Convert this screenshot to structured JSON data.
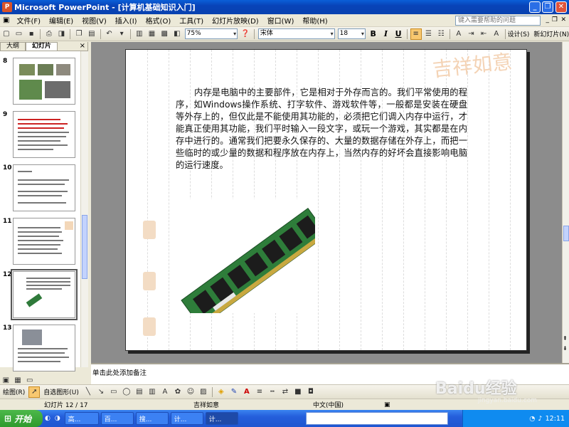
{
  "window": {
    "app_icon": "P",
    "title": "Microsoft PowerPoint - [计算机基础知识入门]",
    "minimize": "_",
    "restore": "❐",
    "close": "✕"
  },
  "menu": {
    "items": [
      "文件(F)",
      "编辑(E)",
      "视图(V)",
      "插入(I)",
      "格式(O)",
      "工具(T)",
      "幻灯片放映(D)",
      "窗口(W)",
      "帮助(H)"
    ],
    "help_placeholder": "键入需要帮助的问题",
    "doc_min": "_",
    "doc_restore": "❐",
    "doc_close": "✕"
  },
  "toolbar": {
    "zoom": "75%",
    "font": "宋体",
    "size": "18",
    "bold": "B",
    "italic": "I",
    "underline": "U",
    "design_label": "设计(S)",
    "new_slide_label": "新幻灯片(N)"
  },
  "pane_tabs": {
    "outline": "大纲",
    "slides": "幻灯片",
    "close": "×"
  },
  "thumbnails": [
    {
      "num": "8"
    },
    {
      "num": "9"
    },
    {
      "num": "10"
    },
    {
      "num": "11"
    },
    {
      "num": "12"
    },
    {
      "num": "13"
    }
  ],
  "slide": {
    "text": "内存是电脑中的主要部件，它是相对于外存而言的。我们平常使用的程序，如Windows操作系统、打字软件、游戏软件等，一般都是安装在硬盘等外存上的，但仅此是不能使用其功能的，必须把它们调入内存中运行，才能真正使用其功能，我们平时输入一段文字，或玩一个游戏，其实都是在内存中进行的。通常我们把要永久保存的、大量的数据存储在外存上，而把一些临时的或少量的数据和程序放在内存上，当然内存的好坏会直接影响电脑的运行速度。",
    "watermark": "吉祥如意"
  },
  "notes": {
    "placeholder": "单击此处添加备注"
  },
  "drawing": {
    "draw_label": "绘图(R)",
    "autoshapes_label": "自选图形(U)"
  },
  "status": {
    "slide": "幻灯片 12 / 17",
    "design": "吉祥如意",
    "language": "中文(中国)"
  },
  "taskbar": {
    "start": "开始",
    "tasks": [
      "高...",
      "百...",
      "搜...",
      "计...",
      "计..."
    ],
    "clock": "12:11"
  },
  "watermark": {
    "brand": "Baidu经验",
    "url": "jingyan.baidu.com"
  }
}
